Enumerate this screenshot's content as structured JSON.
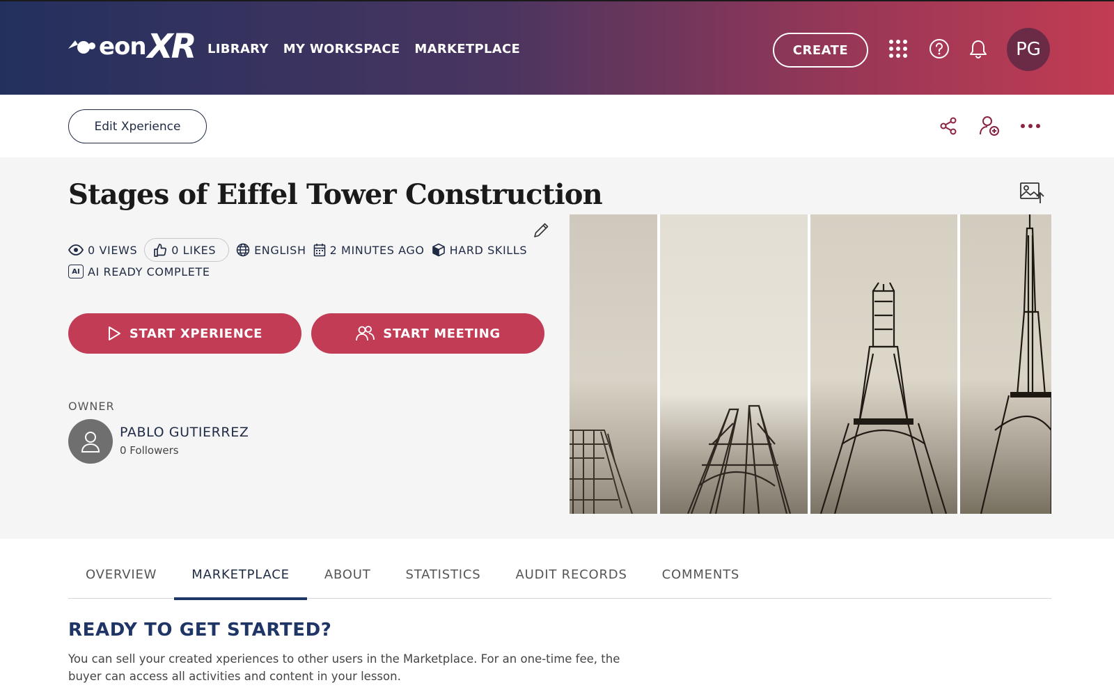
{
  "app": {
    "logo_text_eon": "eon",
    "logo_text_xr": "XR"
  },
  "nav": {
    "items": [
      "LIBRARY",
      "MY WORKSPACE",
      "MARKETPLACE"
    ],
    "create_label": "CREATE",
    "user_initials": "PG"
  },
  "toolbar": {
    "edit_label": "Edit Xperience"
  },
  "xperience": {
    "title": "Stages of Eiffel Tower Construction",
    "views": "0 VIEWS",
    "likes": "0 LIKES",
    "language": "ENGLISH",
    "updated": "2 MINUTES AGO",
    "category": "HARD SKILLS",
    "ai_badge": "AI",
    "ai_status": "AI READY COMPLETE",
    "start_xperience_label": "START XPERIENCE",
    "start_meeting_label": "START MEETING"
  },
  "owner": {
    "label": "OWNER",
    "name": "PABLO GUTIERREZ",
    "followers": "0 Followers"
  },
  "tabs": [
    {
      "label": "OVERVIEW",
      "active": false
    },
    {
      "label": "MARKETPLACE",
      "active": true
    },
    {
      "label": "ABOUT",
      "active": false
    },
    {
      "label": "STATISTICS",
      "active": false
    },
    {
      "label": "AUDIT RECORDS",
      "active": false
    },
    {
      "label": "COMMENTS",
      "active": false
    }
  ],
  "marketplace": {
    "heading": "READY TO GET STARTED?",
    "body": "You can sell your created xperiences to other users in the Marketplace. For an one-time fee, the buyer can access all activities and content in your lesson."
  },
  "colors": {
    "accent": "#c23c56",
    "navy": "#1f3566",
    "gradient_start": "#23305e",
    "gradient_end": "#c23c52"
  },
  "icons": {
    "apps": "grid-icon",
    "help": "help-icon",
    "notifications": "bell-icon",
    "share": "share-icon",
    "add_user": "add-collaborator-icon",
    "more": "more-icon",
    "upload_image": "image-upload-icon"
  }
}
